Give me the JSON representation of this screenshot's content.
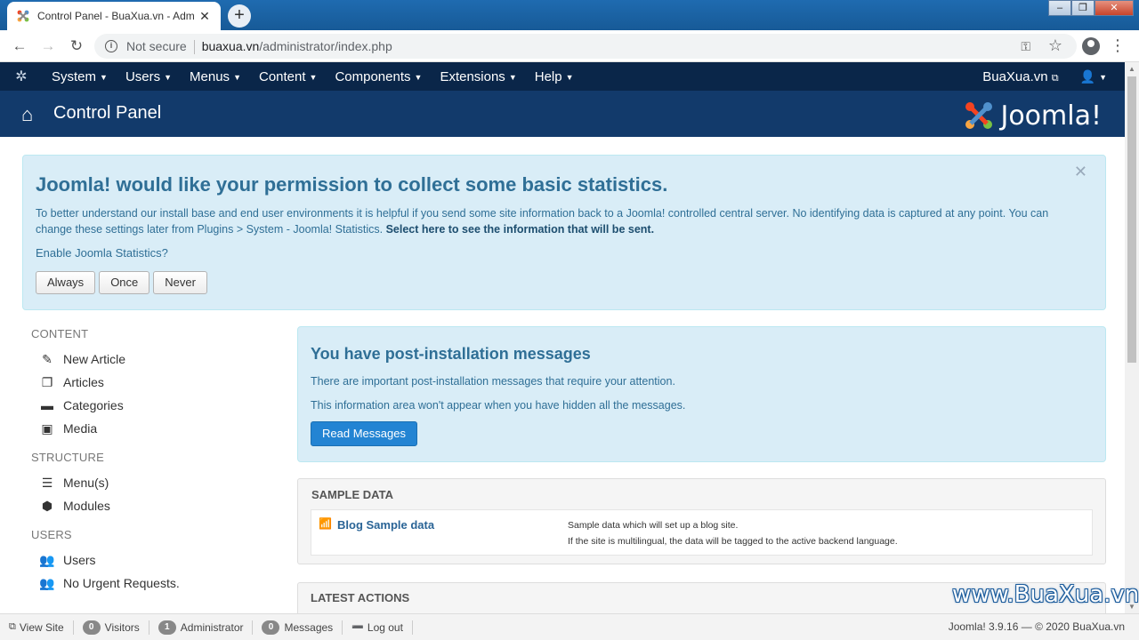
{
  "browser": {
    "tab_title": "Control Panel - BuaXua.vn - Adm",
    "security_text": "Not secure",
    "url_host": "buaxua.vn",
    "url_path": "/administrator/index.php"
  },
  "topnav": {
    "items": [
      {
        "label": "System"
      },
      {
        "label": "Users"
      },
      {
        "label": "Menus"
      },
      {
        "label": "Content"
      },
      {
        "label": "Components"
      },
      {
        "label": "Extensions"
      },
      {
        "label": "Help"
      }
    ],
    "site_link": "BuaXua.vn"
  },
  "header": {
    "title": "Control Panel",
    "brand": "Joomla!"
  },
  "stats_alert": {
    "heading": "Joomla! would like your permission to collect some basic statistics.",
    "description": "To better understand our install base and end user environments it is helpful if you send some site information back to a Joomla! controlled central server. No identifying data is captured at any point. You can change these settings later from Plugins > System - Joomla! Statistics.",
    "link_text": "Select here to see the information that will be sent.",
    "question": "Enable Joomla Statistics?",
    "buttons": {
      "always": "Always",
      "once": "Once",
      "never": "Never"
    }
  },
  "sidebar": {
    "content": {
      "title": "CONTENT",
      "items": [
        {
          "label": "New Article",
          "icon": "pencil-icon"
        },
        {
          "label": "Articles",
          "icon": "stack-icon"
        },
        {
          "label": "Categories",
          "icon": "folder-icon"
        },
        {
          "label": "Media",
          "icon": "image-icon"
        }
      ]
    },
    "structure": {
      "title": "STRUCTURE",
      "items": [
        {
          "label": "Menu(s)",
          "icon": "list-icon"
        },
        {
          "label": "Modules",
          "icon": "cube-icon"
        }
      ]
    },
    "users": {
      "title": "USERS",
      "items": [
        {
          "label": "Users",
          "icon": "users-icon"
        },
        {
          "label": "No Urgent Requests.",
          "icon": "users-icon"
        }
      ]
    }
  },
  "post_install": {
    "heading": "You have post-installation messages",
    "line1": "There are important post-installation messages that require your attention.",
    "line2": "This information area won't appear when you have hidden all the messages.",
    "button": "Read Messages"
  },
  "sample_data": {
    "title": "SAMPLE DATA",
    "row": {
      "name": "Blog Sample data",
      "desc1": "Sample data which will set up a blog site.",
      "desc2": "If the site is multilingual, the data will be tagged to the active backend language."
    }
  },
  "latest_actions": {
    "title": "LATEST ACTIONS"
  },
  "watermark": "www.BuaXua.vn",
  "statusbar": {
    "view_site": "View Site",
    "visitors_count": "0",
    "visitors_label": "Visitors",
    "admin_count": "1",
    "admin_label": "Administrator",
    "messages_count": "0",
    "messages_label": "Messages",
    "logout": "Log out",
    "version": "Joomla! 3.9.16",
    "copyright": "— © 2020 BuaXua.vn"
  },
  "colors": {
    "nav_bg": "#0a2649",
    "header_bg": "#123a6b",
    "alert_bg": "#d9edf7",
    "primary_button": "#2384d3"
  }
}
